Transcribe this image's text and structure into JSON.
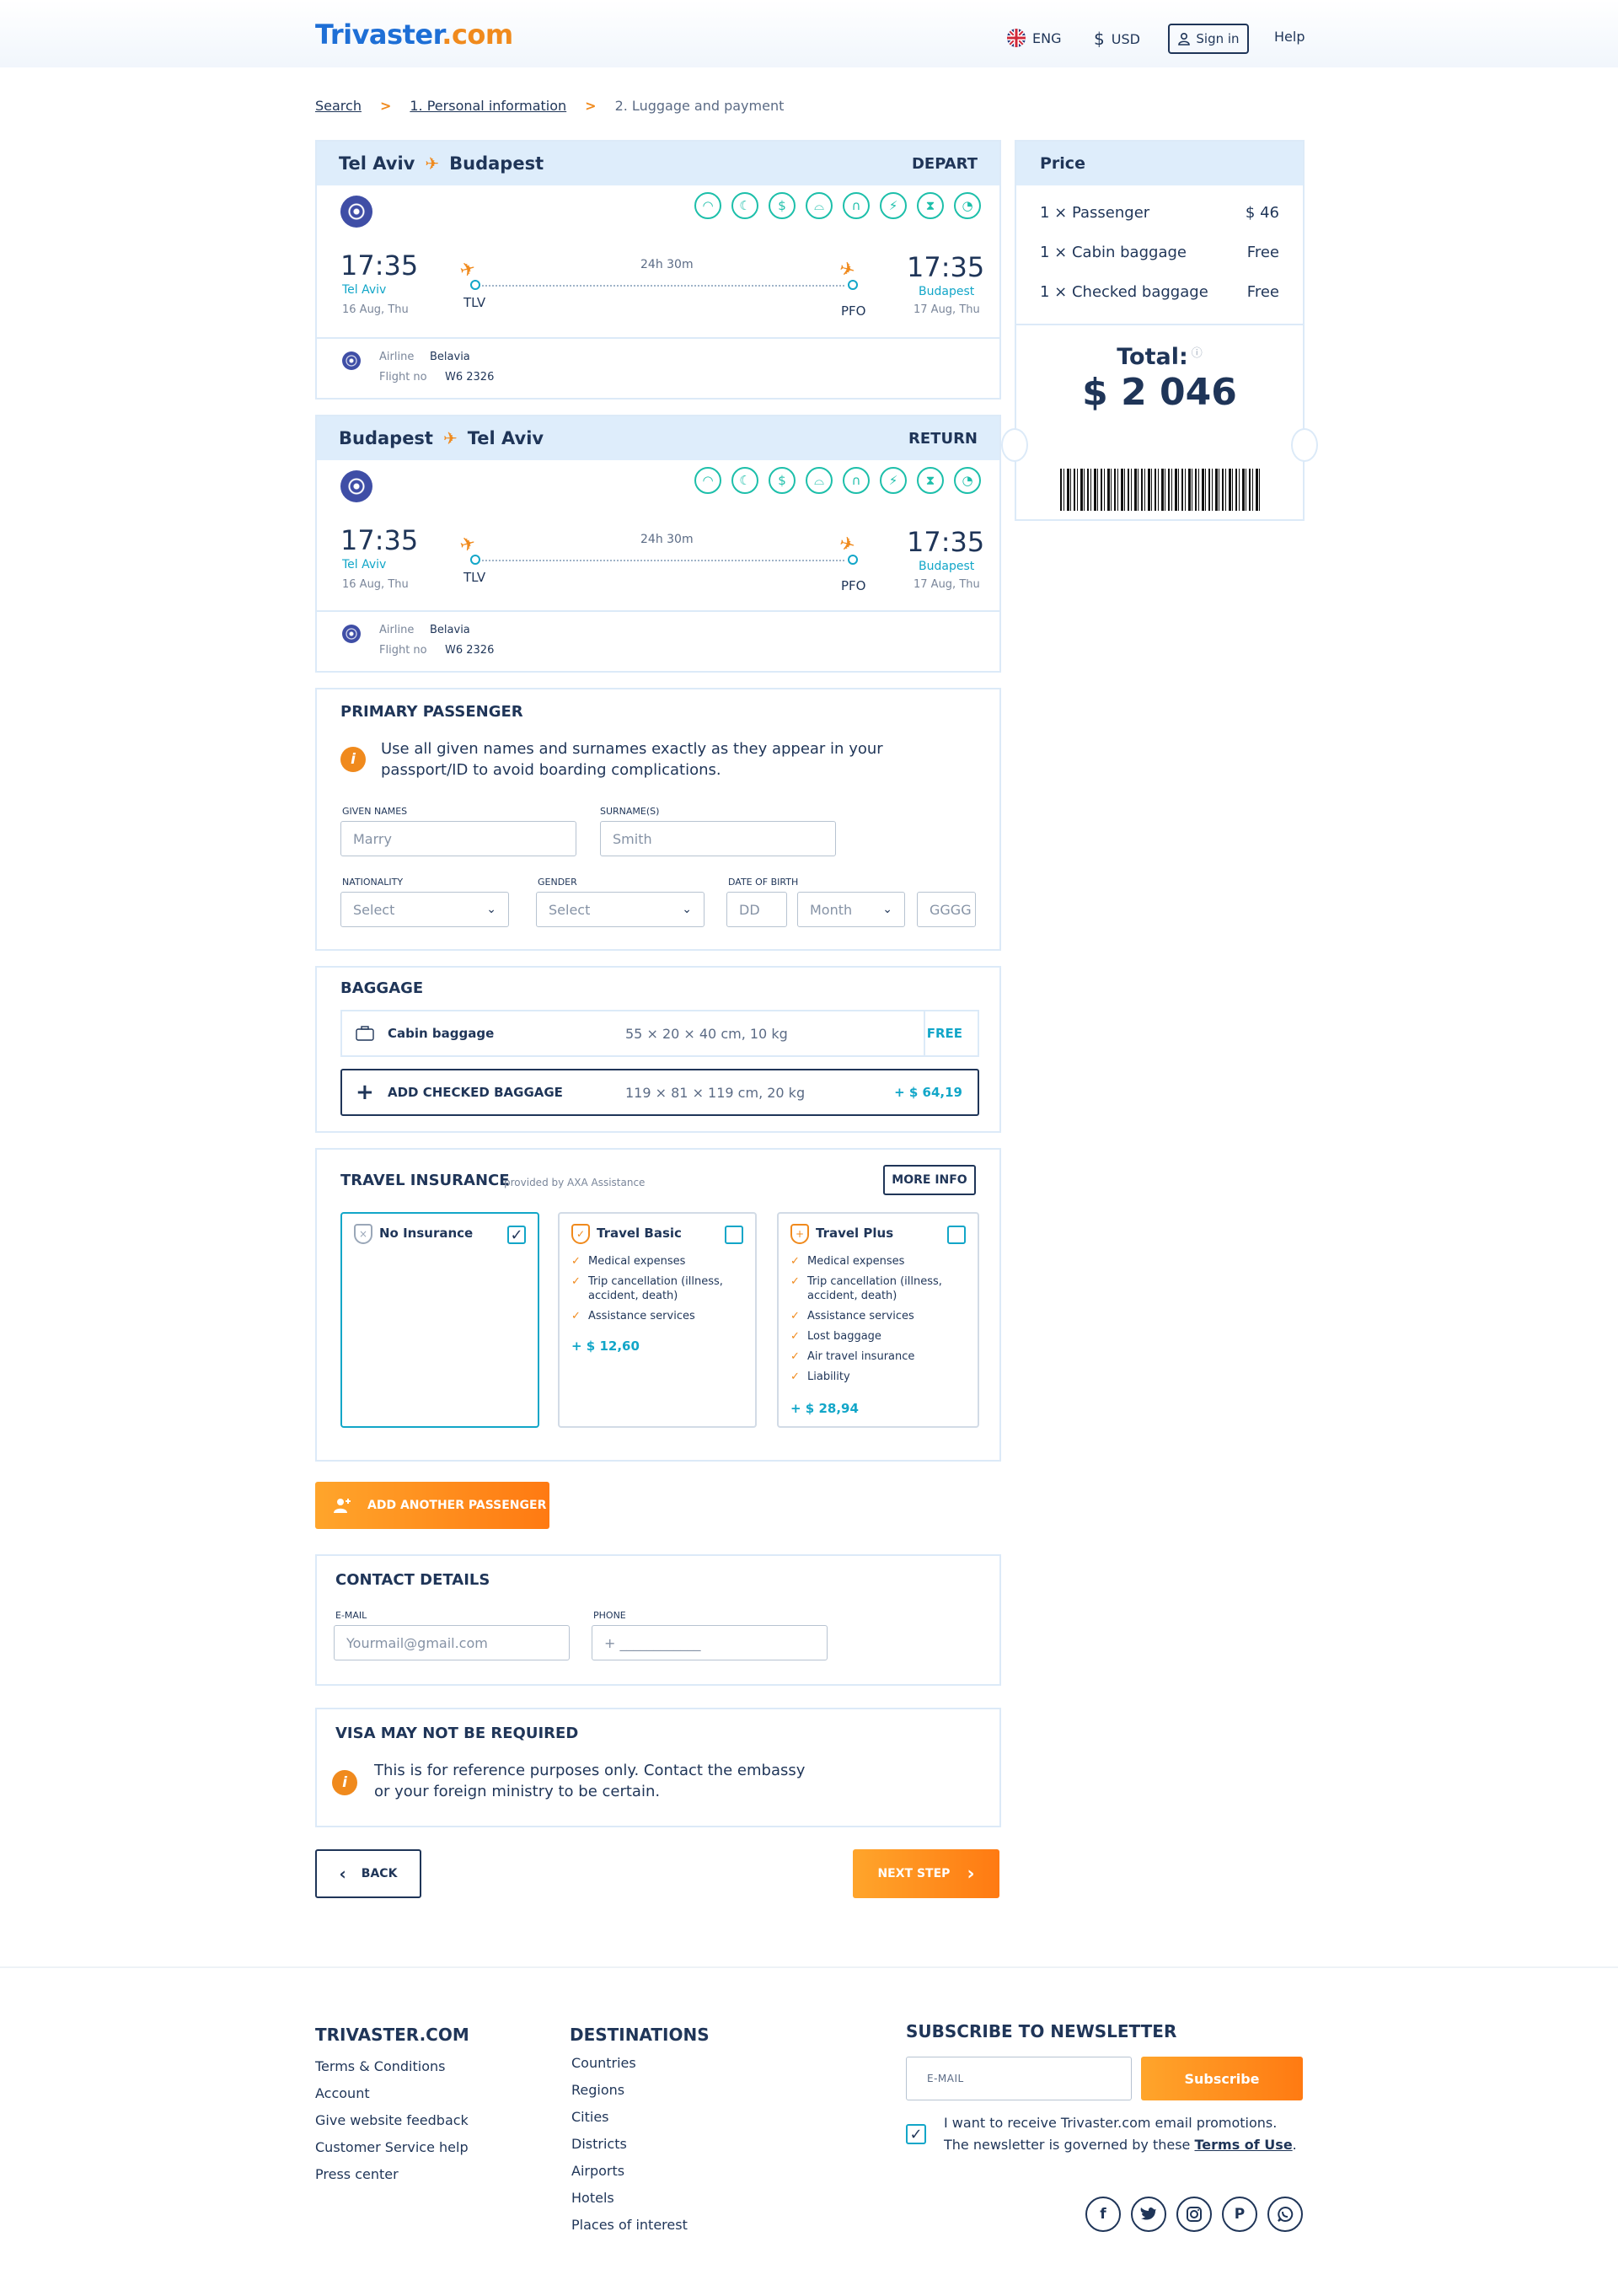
{
  "header": {
    "logo_main": "Trivaster",
    "logo_tld": ".com",
    "language": "ENG",
    "currency_symbol": "$",
    "currency": "USD",
    "sign_in": "Sign in",
    "help": "Help"
  },
  "breadcrumb": {
    "search": "Search",
    "step1": "1. Personal information",
    "step2": "2. Luggage and payment",
    "separator": ">"
  },
  "flights": [
    {
      "from": "Tel Aviv",
      "to": "Budapest",
      "tag": "DEPART",
      "dep_time": "17:35",
      "dep_city": "Tel Aviv",
      "dep_date": "16 Aug, Thu",
      "arr_time": "17:35",
      "arr_city": "Budapest",
      "arr_date": "17 Aug, Thu",
      "duration": "24h 30m",
      "dep_code": "TLV",
      "arr_code": "PFO",
      "airline_label": "Airline",
      "airline": "Belavia",
      "flight_no_label": "Flight no",
      "flight_no": "W6 2326"
    },
    {
      "from": "Budapest",
      "to": "Tel Aviv",
      "tag": "RETURN",
      "dep_time": "17:35",
      "dep_city": "Tel Aviv",
      "dep_date": "16 Aug, Thu",
      "arr_time": "17:35",
      "arr_city": "Budapest",
      "arr_date": "17 Aug, Thu",
      "duration": "24h 30m",
      "dep_code": "TLV",
      "arr_code": "PFO",
      "airline_label": "Airline",
      "airline": "Belavia",
      "flight_no_label": "Flight no",
      "flight_no": "W6 2326"
    }
  ],
  "amenity_icons": [
    "wifi-icon",
    "night-icon",
    "dollar-icon",
    "meal-icon",
    "headphones-icon",
    "power-icon",
    "hourglass-icon",
    "timer-icon"
  ],
  "price": {
    "title": "Price",
    "rows": [
      {
        "label": "1 × Passenger",
        "value": "$ 46"
      },
      {
        "label": "1 × Cabin baggage",
        "value": "Free"
      },
      {
        "label": "1 × Checked baggage",
        "value": "Free"
      }
    ],
    "total_label": "Total:",
    "total": "$ 2 046"
  },
  "passenger": {
    "title": "PRIMARY PASSENGER",
    "note_line1": "Use all given names and surnames exactly as they appear in your",
    "note_line2": "passport/ID to avoid boarding complications.",
    "given_label": "GIVEN NAMES",
    "given_placeholder": "Marry",
    "surname_label": "SURNAME(S)",
    "surname_placeholder": "Smith",
    "nationality_label": "NATIONALITY",
    "nationality_value": "Select",
    "gender_label": "GENDER",
    "gender_value": "Select",
    "dob_label": "DATE OF BIRTH",
    "dob_day": "DD",
    "dob_month": "Month",
    "dob_year": "GGGG"
  },
  "baggage": {
    "title": "BAGGAGE",
    "cabin_name": "Cabin baggage",
    "cabin_dims": "55 × 20 × 40 cm, 10 kg",
    "cabin_price": "FREE",
    "checked_name": "ADD CHECKED BAGGAGE",
    "checked_dims": "119 × 81 × 119 cm, 20 kg",
    "checked_price": "+ $ 64,19"
  },
  "insurance": {
    "title": "TRAVEL INSURANCE",
    "provider": "provided by AXA Assistance",
    "more_info": "MORE INFO",
    "options": [
      {
        "name": "No Insurance",
        "items": [],
        "price": "",
        "selected": true
      },
      {
        "name": "Travel Basic",
        "items": [
          "Medical expenses",
          "Trip cancellation (illness, accident, death)",
          "Assistance services"
        ],
        "price": "+ $ 12,60",
        "selected": false
      },
      {
        "name": "Travel Plus",
        "items": [
          "Medical expenses",
          "Trip cancellation (illness, accident, death)",
          "Assistance services",
          "Lost baggage",
          "Air travel insurance",
          "Liability"
        ],
        "price": "+ $ 28,94",
        "selected": false
      }
    ]
  },
  "add_passenger": "ADD ANOTHER PASSENGER",
  "contact": {
    "title": "CONTACT DETAILS",
    "email_label": "E-MAIL",
    "email_placeholder": "Yourmail@gmail.com",
    "phone_label": "PHONE",
    "phone_placeholder": "+ ____________"
  },
  "visa": {
    "title": "VISA MAY NOT BE REQUIRED",
    "line1": "This is for reference purposes only. Contact the embassy",
    "line2": "or your foreign ministry to be certain."
  },
  "nav": {
    "back": "BACK",
    "next": "NEXT STEP"
  },
  "footer": {
    "col1_title": "TRIVASTER.COM",
    "col1_links": [
      "Terms & Conditions",
      "Account",
      "Give website feedback",
      "Customer Service help",
      "Press center"
    ],
    "col2_title": "DESTINATIONS",
    "col2_links": [
      "Countries",
      "Regions",
      "Cities",
      "Districts",
      "Airports",
      "Hotels",
      "Places of interest"
    ],
    "newsletter_title": "SUBSCRIBE TO NEWSLETTER",
    "email_placeholder": "E-MAIL",
    "subscribe": "Subscribe",
    "consent_line1": "I want to receive Trivaster.com email promotions.",
    "consent_line2": "The newsletter is governed by these",
    "terms_link": "Terms of Use",
    "consent_end": ".",
    "social": [
      "facebook-icon",
      "twitter-icon",
      "instagram-icon",
      "pinterest-icon",
      "whatsapp-icon"
    ]
  },
  "colors": {
    "navy": "#1f3558",
    "teal": "#12a6c8",
    "orange": "#f08a1d",
    "light_blue": "#deedfb"
  }
}
